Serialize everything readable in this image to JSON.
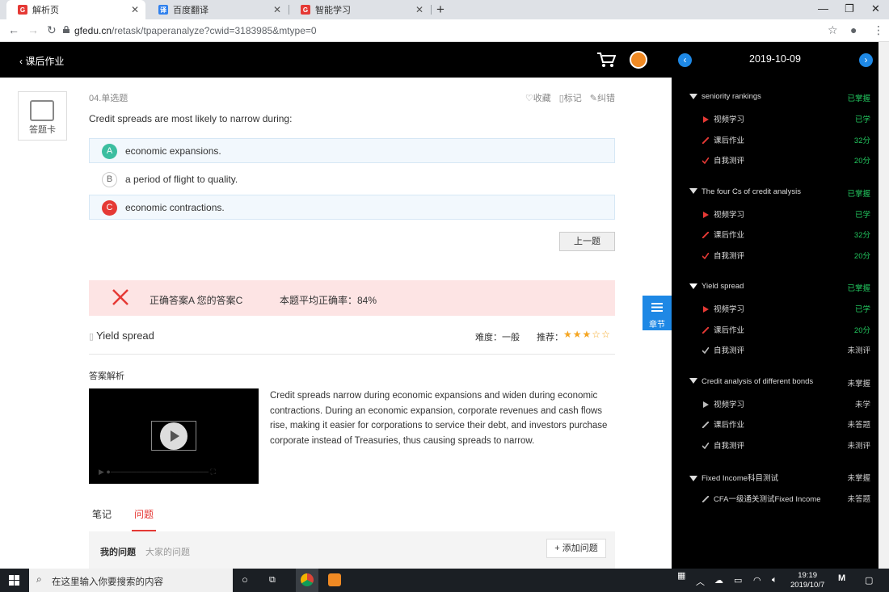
{
  "browser": {
    "tabs": [
      {
        "title": "解析页",
        "icon": "gfedu-icon"
      },
      {
        "title": "百度翻译",
        "icon": "baidu-translate-icon"
      },
      {
        "title": "智能学习",
        "icon": "gfedu-icon"
      }
    ],
    "url_host": "gfedu.cn",
    "url_path": "/retask/tpaperanalyze?cwid=3183985&mtype=0"
  },
  "header": {
    "back_label": "课后作业"
  },
  "answer_card_label": "答题卡",
  "question": {
    "number": "04.单选题",
    "actions": {
      "favorite": "收藏",
      "mark": "标记",
      "report": "纠错"
    },
    "text": "Credit spreads are most likely to narrow during:",
    "options": [
      {
        "letter": "A",
        "text": "economic expansions.",
        "state": "correct"
      },
      {
        "letter": "B",
        "text": "a period of flight to quality.",
        "state": "normal"
      },
      {
        "letter": "C",
        "text": "economic contractions.",
        "state": "wrong"
      }
    ],
    "prev_button": "上一题"
  },
  "result": {
    "answer_text": "正确答案A 您的答案C",
    "accuracy_text": "本题平均正确率：84%"
  },
  "topic": {
    "name": "Yield spread",
    "difficulty": "难度：一般",
    "recommend_label": "推荐：",
    "stars": 3,
    "stars_max": 5
  },
  "analysis": {
    "label": "答案解析",
    "text": "Credit spreads narrow during economic expansions and widen during economic contractions. During an economic expansion, corporate revenues and cash flows rise, making it easier for corporations to service their debt, and investors purchase corporate instead of Treasuries, thus causing spreads to narrow."
  },
  "notes_tabs": [
    "笔记",
    "问题"
  ],
  "questions_panel": {
    "mine": "我的问题",
    "all": "大家的问题",
    "add_button": "+ 添加问题"
  },
  "chapter_tab_label": "章节",
  "sidebar": {
    "date": "2019-10-09",
    "colors": {
      "mastered": "#22c55e",
      "pending": "#cccccc"
    },
    "sections": [
      {
        "title": "seniority rankings",
        "status": "已掌握",
        "status_kind": "mastered",
        "items": [
          {
            "label": "视频学习",
            "status": "已学",
            "icon": "video-icon",
            "kind": "mastered"
          },
          {
            "label": "课后作业",
            "status": "32分",
            "icon": "homework-icon",
            "kind": "mastered"
          },
          {
            "label": "自我测评",
            "status": "20分",
            "icon": "check-icon",
            "kind": "mastered"
          }
        ]
      },
      {
        "title": "The four Cs of credit analysis",
        "status": "已掌握",
        "status_kind": "mastered",
        "items": [
          {
            "label": "视频学习",
            "status": "已学",
            "icon": "video-icon",
            "kind": "mastered"
          },
          {
            "label": "课后作业",
            "status": "32分",
            "icon": "homework-icon",
            "kind": "mastered"
          },
          {
            "label": "自我测评",
            "status": "20分",
            "icon": "check-icon",
            "kind": "mastered"
          }
        ]
      },
      {
        "title": "Yield spread",
        "status": "已掌握",
        "status_kind": "mastered",
        "items": [
          {
            "label": "视频学习",
            "status": "已学",
            "icon": "video-icon",
            "kind": "mastered"
          },
          {
            "label": "课后作业",
            "status": "20分",
            "icon": "homework-icon",
            "kind": "mastered"
          },
          {
            "label": "自我测评",
            "status": "未测评",
            "icon": "check-icon",
            "kind": "pending"
          }
        ]
      },
      {
        "title": "Credit analysis of different bonds",
        "status": "未掌握",
        "status_kind": "pending",
        "items": [
          {
            "label": "视频学习",
            "status": "未学",
            "icon": "video-icon",
            "kind": "pending"
          },
          {
            "label": "课后作业",
            "status": "未答题",
            "icon": "homework-icon",
            "kind": "pending"
          },
          {
            "label": "自我测评",
            "status": "未测评",
            "icon": "check-icon",
            "kind": "pending"
          }
        ]
      },
      {
        "title": "Fixed Income科目测试",
        "status": "未掌握",
        "status_kind": "pending",
        "items": [
          {
            "label": "CFA一级通关测试Fixed Income",
            "status": "未答题",
            "icon": "homework-icon",
            "kind": "pending"
          }
        ]
      }
    ]
  },
  "taskbar": {
    "search_placeholder": "在这里输入你要搜索的内容",
    "time": "19:19",
    "date": "2019/10/7"
  }
}
